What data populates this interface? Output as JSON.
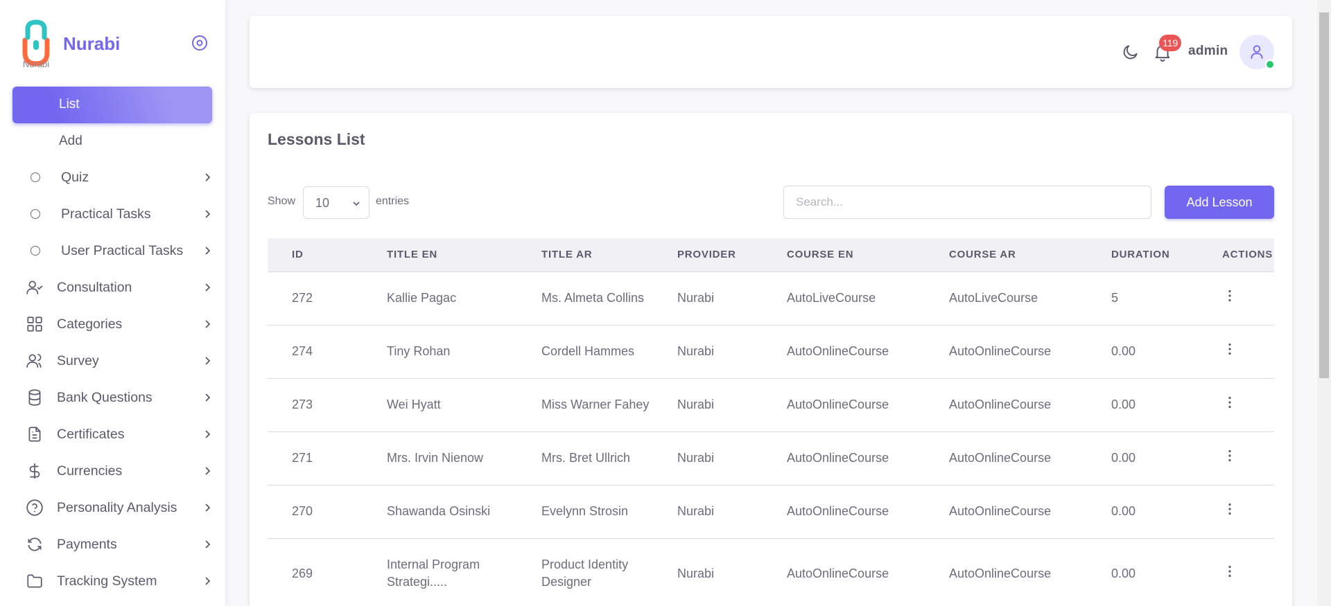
{
  "brand": {
    "name": "Nurabi",
    "logo_text": "Nurabi"
  },
  "sidebar": {
    "active_item": "List",
    "sub_add": "Add",
    "items": [
      {
        "label": "Quiz",
        "icon": "circle-icon"
      },
      {
        "label": "Practical Tasks",
        "icon": "circle-icon"
      },
      {
        "label": "User Practical Tasks",
        "icon": "circle-icon"
      },
      {
        "label": "Consultation",
        "icon": "user-check-icon"
      },
      {
        "label": "Categories",
        "icon": "grid-icon"
      },
      {
        "label": "Survey",
        "icon": "users-icon"
      },
      {
        "label": "Bank Questions",
        "icon": "database-icon"
      },
      {
        "label": "Certificates",
        "icon": "file-text-icon"
      },
      {
        "label": "Currencies",
        "icon": "dollar-icon"
      },
      {
        "label": "Personality Analysis",
        "icon": "help-circle-icon"
      },
      {
        "label": "Payments",
        "icon": "refresh-icon"
      },
      {
        "label": "Tracking System",
        "icon": "folder-icon"
      }
    ]
  },
  "navbar": {
    "notification_count": "119",
    "username": "admin"
  },
  "main": {
    "title": "Lessons List",
    "show_label": "Show",
    "entries_value": "10",
    "entries_label": "entries",
    "search_placeholder": "Search...",
    "add_button": "Add Lesson",
    "columns": [
      "ID",
      "TITLE EN",
      "TITLE AR",
      "PROVIDER",
      "COURSE EN",
      "COURSE AR",
      "DURATION",
      "ACTIONS"
    ],
    "rows": [
      {
        "id": "272",
        "title_en": "Kallie Pagac",
        "title_ar": "Ms. Almeta Collins",
        "provider": "Nurabi",
        "course_en": "AutoLiveCourse",
        "course_ar": "AutoLiveCourse",
        "duration": "5"
      },
      {
        "id": "274",
        "title_en": "Tiny Rohan",
        "title_ar": "Cordell Hammes",
        "provider": "Nurabi",
        "course_en": "AutoOnlineCourse",
        "course_ar": "AutoOnlineCourse",
        "duration": "0.00"
      },
      {
        "id": "273",
        "title_en": "Wei Hyatt",
        "title_ar": "Miss Warner Fahey",
        "provider": "Nurabi",
        "course_en": "AutoOnlineCourse",
        "course_ar": "AutoOnlineCourse",
        "duration": "0.00"
      },
      {
        "id": "271",
        "title_en": "Mrs. Irvin Nienow",
        "title_ar": "Mrs. Bret Ullrich",
        "provider": "Nurabi",
        "course_en": "AutoOnlineCourse",
        "course_ar": "AutoOnlineCourse",
        "duration": "0.00"
      },
      {
        "id": "270",
        "title_en": "Shawanda Osinski",
        "title_ar": "Evelynn Strosin",
        "provider": "Nurabi",
        "course_en": "AutoOnlineCourse",
        "course_ar": "AutoOnlineCourse",
        "duration": "0.00"
      },
      {
        "id": "269",
        "title_en": "Internal Program Strategi.....",
        "title_ar": "Product Identity Designer",
        "provider": "Nurabi",
        "course_en": "AutoOnlineCourse",
        "course_ar": "AutoOnlineCourse",
        "duration": "0.00"
      }
    ]
  },
  "colors": {
    "accent": "#7367f0",
    "badge": "#ea5455",
    "online": "#28c76f",
    "logo_teal": "#2ec4c4",
    "logo_orange": "#ff6b3d"
  }
}
